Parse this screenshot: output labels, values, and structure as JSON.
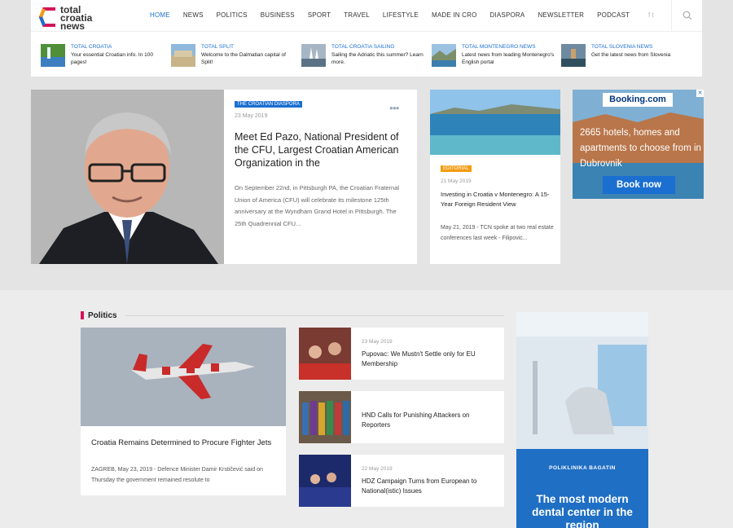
{
  "site": {
    "logo": [
      "total",
      "croatia",
      "news"
    ],
    "nav": [
      "Home",
      "News",
      "Politics",
      "Business",
      "Sport",
      "Travel",
      "Lifestyle",
      "Made in CRO",
      "Diaspora",
      "Newsletter",
      "Podcast"
    ],
    "active_nav": "Home",
    "social": "f  t"
  },
  "portals": [
    {
      "title": "TOTAL CROATIA",
      "desc": "Your essential Croatian info. In 100 pages!"
    },
    {
      "title": "TOTAL SPLIT",
      "desc": "Welcome to the Dalmatian capital of Split!"
    },
    {
      "title": "TOTAL CROATIA SAILING",
      "desc": "Sailing the Adriatic this summer? Learn more."
    },
    {
      "title": "TOTAL MONTENEGRO NEWS",
      "desc": "Latest news from leading Montenegro's English portal"
    },
    {
      "title": "TOTAL SLOVENIA NEWS",
      "desc": "Get the latest news from Slovenia"
    }
  ],
  "featured": {
    "category": "THE CROATIAN DIASPORA",
    "date": "23 May 2019",
    "title": "Meet Ed Pazo, National President of the CFU, Largest Croatian American Organization in the",
    "excerpt": "On September 22nd, in Pittsburgh PA, the Croatian Fraternal Union of America (CFU) will celebrate its milestone 125th anniversary at the Wyndham Grand Hotel in Pittsburgh. The 25th Quadrennial CFU..."
  },
  "editorial": {
    "category": "EDITORIAL",
    "date": "21 May 2019",
    "title": "Investing in Croatia v Montenegro: A 15-Year Foreign Resident View",
    "excerpt": "May 21, 2019 - TCN spoke at two real estate conferences last week - Filipovic..."
  },
  "ad_booking": {
    "logo": "Booking.com",
    "text": "2665 hotels, homes and apartments to choose from in Dubrovnik",
    "button": "Book now",
    "close": "✕"
  },
  "politics": {
    "section_title": "Politics",
    "main": {
      "title": "Croatia Remains Determined to Procure Fighter Jets",
      "excerpt": "ZAGREB, May 23, 2019 - Defence Minister Damir Krstičević said on Thursday the government remained resolute to"
    },
    "side": [
      {
        "date": "23 May 2019",
        "title": "Pupovac: We Mustn't Settle only for EU Membership"
      },
      {
        "date": "22 May 2019",
        "title": "HND Calls for Punishing Attackers on Reporters"
      },
      {
        "date": "22 May 2019",
        "title": "HDZ Campaign Turns from European to National(istic) Issues"
      }
    ]
  },
  "ad_dental": {
    "logo": "POLIKLINIKA BAGATIN",
    "text": "The most modern dental center in the region"
  },
  "colors": {
    "accent": "#1a6fd0",
    "section_marker": "#d4145a",
    "editorial": "#f39c12"
  }
}
